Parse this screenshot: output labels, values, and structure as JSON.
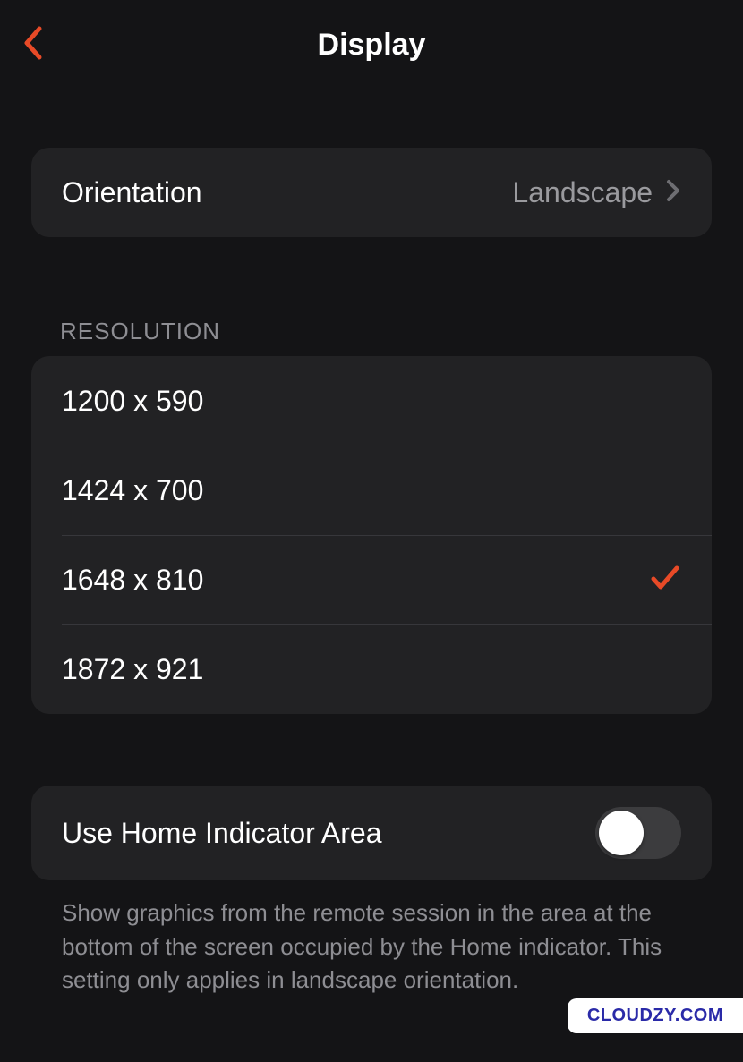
{
  "colors": {
    "accent": "#e84a27",
    "secondary_text": "#8e8e93"
  },
  "header": {
    "title": "Display"
  },
  "orientation": {
    "label": "Orientation",
    "value": "Landscape"
  },
  "resolution": {
    "heading": "RESOLUTION",
    "options": [
      {
        "label": "1200 x 590",
        "selected": false
      },
      {
        "label": "1424 x 700",
        "selected": false
      },
      {
        "label": "1648 x 810",
        "selected": true
      },
      {
        "label": "1872 x 921",
        "selected": false
      }
    ]
  },
  "home_indicator": {
    "label": "Use Home Indicator Area",
    "enabled": false,
    "description": "Show graphics from the remote session in the area at the bottom of the screen occupied by the Home indicator. This setting only applies in landscape orientation."
  },
  "watermark": "CLOUDZY.COM"
}
